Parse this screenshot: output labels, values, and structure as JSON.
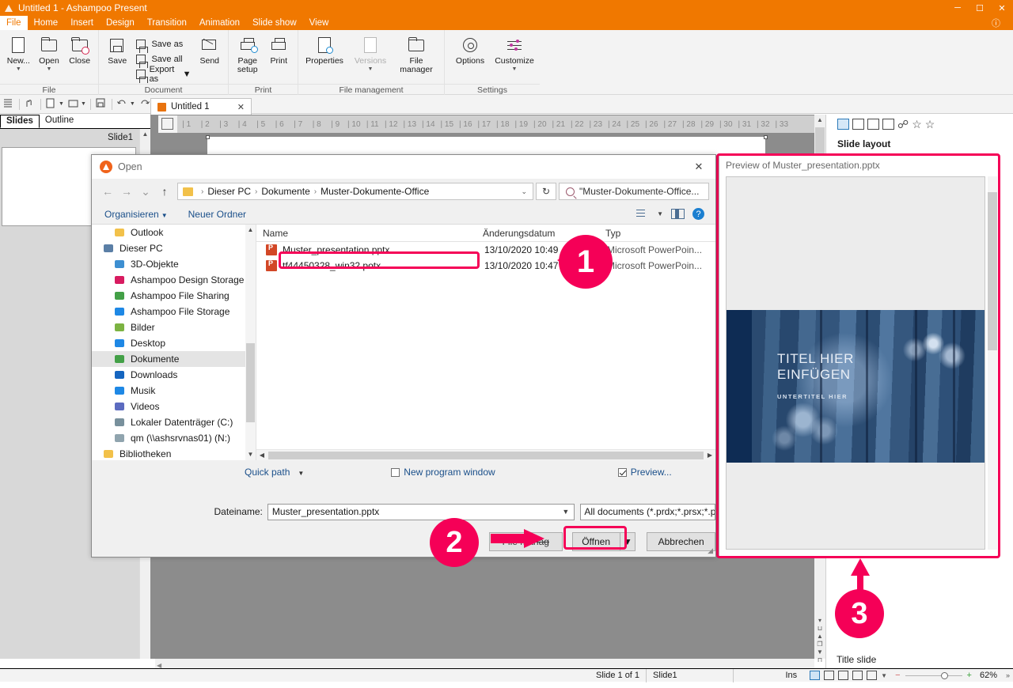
{
  "window": {
    "title": "Untitled 1 - Ashampoo Present",
    "minimize": "─",
    "maximize": "☐",
    "close": "✕"
  },
  "menu": {
    "items": [
      "File",
      "Home",
      "Insert",
      "Design",
      "Transition",
      "Animation",
      "Slide show",
      "View"
    ],
    "active": "File"
  },
  "ribbon": {
    "groups": [
      {
        "name": "File",
        "buttons": [
          {
            "label": "New...",
            "icon": "new-document-icon",
            "dropdown": true,
            "disabled": false
          },
          {
            "label": "Open",
            "icon": "open-folder-icon",
            "dropdown": true,
            "disabled": false
          },
          {
            "label": "Close",
            "icon": "close-folder-icon",
            "dropdown": false,
            "disabled": false
          }
        ]
      },
      {
        "name": "Document",
        "buttons": [
          {
            "label": "Save",
            "icon": "save-disk-icon",
            "dropdown": false,
            "disabled": false
          }
        ],
        "small": [
          {
            "label": "Save as",
            "icon": "save-as-icon"
          },
          {
            "label": "Save all",
            "icon": "save-all-icon"
          },
          {
            "label": "Export as",
            "icon": "export-as-icon",
            "dropdown": true
          }
        ],
        "buttons2": [
          {
            "label": "Send",
            "icon": "send-envelope-icon",
            "dropdown": false,
            "disabled": false
          }
        ]
      },
      {
        "name": "Print",
        "buttons": [
          {
            "label": "Page setup",
            "icon": "page-setup-icon",
            "dropdown": false,
            "disabled": false
          },
          {
            "label": "Print",
            "icon": "printer-icon",
            "dropdown": false,
            "disabled": false
          }
        ]
      },
      {
        "name": "File management",
        "buttons": [
          {
            "label": "Properties",
            "icon": "properties-icon",
            "dropdown": false,
            "disabled": false
          },
          {
            "label": "Versions",
            "icon": "versions-icon",
            "dropdown": true,
            "disabled": true
          },
          {
            "label": "File manager",
            "icon": "file-manager-icon",
            "dropdown": false,
            "disabled": false
          }
        ]
      },
      {
        "name": "Settings",
        "buttons": [
          {
            "label": "Options",
            "icon": "gear-icon",
            "dropdown": false,
            "disabled": false
          },
          {
            "label": "Customize",
            "icon": "sliders-icon",
            "dropdown": true,
            "disabled": false
          }
        ]
      }
    ]
  },
  "doc_tab": {
    "label": "Untitled 1",
    "close": "✕"
  },
  "left_pane": {
    "tabs": [
      {
        "label": "Slides",
        "selected": true
      },
      {
        "label": "Outline",
        "selected": false
      }
    ],
    "slide_header": "Slide1"
  },
  "ruler": {
    "ticks": [
      "1",
      "2",
      "3",
      "4",
      "5",
      "6",
      "7",
      "8",
      "9",
      "10",
      "11",
      "12",
      "13",
      "14",
      "15",
      "16",
      "17",
      "18",
      "19",
      "20",
      "21",
      "22",
      "23",
      "24",
      "25",
      "26",
      "27",
      "28",
      "29",
      "30",
      "31",
      "32",
      "33"
    ]
  },
  "right_panel": {
    "title": "Slide layout",
    "bottom_label": "Title slide",
    "icons": [
      "slide-layout-icon",
      "slide-edit-icon",
      "slide-colors-icon",
      "slide-save-icon",
      "link-icon",
      "favorite-add-icon",
      "favorite-icon"
    ]
  },
  "dialog": {
    "title": "Open",
    "close": "✕",
    "nav": {
      "back": "←",
      "forward": "→",
      "recent": "⌄",
      "up": "↑",
      "refresh": "↻"
    },
    "breadcrumb": [
      "Dieser PC",
      "Dokumente",
      "Muster-Dokumente-Office"
    ],
    "breadcrumb_dropdown": "⌄",
    "search_value": "\"Muster-Dokumente-Office...",
    "toolbar": {
      "organize": "Organisieren",
      "new_folder": "Neuer Ordner",
      "help": "?"
    },
    "tree": [
      {
        "label": "Outlook",
        "icon": "folder-icon",
        "selected": false,
        "indent": 1
      },
      {
        "label": "Dieser PC",
        "icon": "pc-icon",
        "selected": false,
        "indent": 0
      },
      {
        "label": "3D-Objekte",
        "icon": "3d-objects-icon",
        "selected": false,
        "indent": 1
      },
      {
        "label": "Ashampoo Design Storage",
        "icon": "ashampoo-design-icon",
        "selected": false,
        "indent": 1
      },
      {
        "label": "Ashampoo File Sharing",
        "icon": "ashampoo-sharing-icon",
        "selected": false,
        "indent": 1
      },
      {
        "label": "Ashampoo File Storage",
        "icon": "ashampoo-storage-icon",
        "selected": false,
        "indent": 1
      },
      {
        "label": "Bilder",
        "icon": "pictures-icon",
        "selected": false,
        "indent": 1
      },
      {
        "label": "Desktop",
        "icon": "desktop-icon",
        "selected": false,
        "indent": 1
      },
      {
        "label": "Dokumente",
        "icon": "documents-icon",
        "selected": true,
        "indent": 1
      },
      {
        "label": "Downloads",
        "icon": "downloads-icon",
        "selected": false,
        "indent": 1
      },
      {
        "label": "Musik",
        "icon": "music-icon",
        "selected": false,
        "indent": 1
      },
      {
        "label": "Videos",
        "icon": "videos-icon",
        "selected": false,
        "indent": 1
      },
      {
        "label": "Lokaler Datenträger (C:)",
        "icon": "drive-icon",
        "selected": false,
        "indent": 1
      },
      {
        "label": "qm (\\\\ashsrvnas01) (N:)",
        "icon": "network-drive-icon",
        "selected": false,
        "indent": 1
      },
      {
        "label": "Bibliotheken",
        "icon": "folder-icon",
        "selected": false,
        "indent": 0
      }
    ],
    "columns": [
      "Name",
      "Änderungsdatum",
      "Typ"
    ],
    "files": [
      {
        "name": "Muster_presentation.pptx",
        "date": "13/10/2020 10:49",
        "type": "Microsoft PowerPoin...",
        "selected": true
      },
      {
        "name": "tf44450328_win32.potx",
        "date": "13/10/2020 10:47",
        "type": "Microsoft PowerPoin...",
        "selected": false
      }
    ],
    "options": {
      "quick_path": "Quick path",
      "new_program_window": {
        "label": "New program window",
        "checked": false
      },
      "preview": {
        "label": "Preview...",
        "checked": true
      }
    },
    "filename": {
      "label": "Dateiname:",
      "value": "Muster_presentation.pptx"
    },
    "filetype": {
      "value": "All documents (*.prdx;*.prsx;*.p"
    },
    "buttons": {
      "file_manager": "File manag",
      "open": "Öffnen",
      "open_dropdown": "▼",
      "cancel": "Abbrechen"
    }
  },
  "preview_window": {
    "title": "Preview of Muster_presentation.pptx",
    "slide": {
      "title": "TITEL HIER\nEINFÜGEN",
      "title_line1": "TITEL HIER",
      "title_line2": "EINFÜGEN",
      "subtitle": "UNTERTITEL HIER"
    }
  },
  "status_bar": {
    "slide_count": "Slide 1 of 1",
    "slide_name": "Slide1",
    "insert_mode": "Ins",
    "zoom": "62%",
    "zoom_minus": "−",
    "zoom_plus": "+"
  },
  "annotations": [
    {
      "number": "1"
    },
    {
      "number": "2"
    },
    {
      "number": "3"
    }
  ],
  "colors": {
    "accent": "#f07800",
    "annotation": "#f50057",
    "slide_navy": "#0e2c54"
  }
}
